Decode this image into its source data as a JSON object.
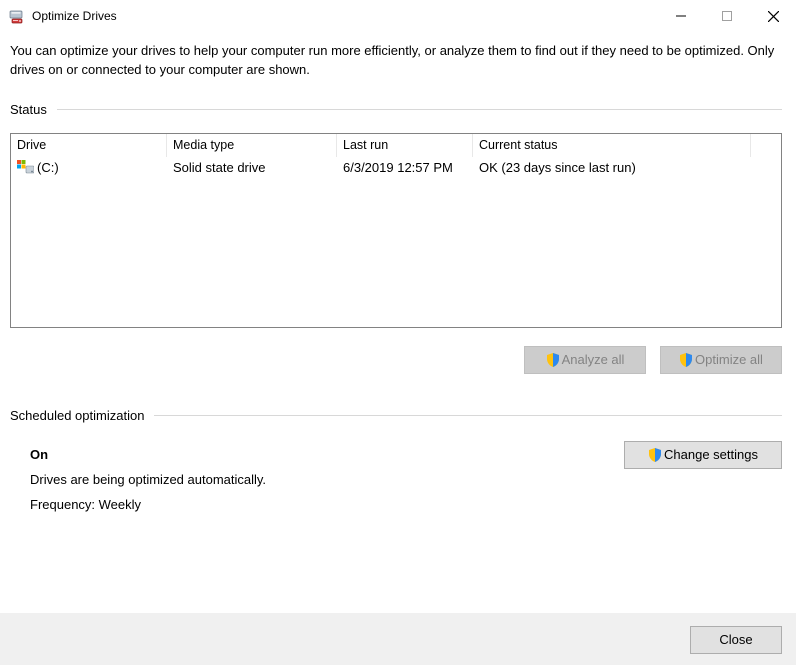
{
  "window": {
    "title": "Optimize Drives"
  },
  "intro": "You can optimize your drives to help your computer run more efficiently, or analyze them to find out if they need to be optimized. Only drives on or connected to your computer are shown.",
  "status": {
    "label": "Status",
    "columns": {
      "drive": "Drive",
      "media": "Media type",
      "last": "Last run",
      "status": "Current status"
    },
    "rows": [
      {
        "drive": "(C:)",
        "media": "Solid state drive",
        "last": "6/3/2019 12:57 PM",
        "status": "OK (23 days since last run)"
      }
    ],
    "analyze": "Analyze all",
    "optimize": "Optimize all"
  },
  "scheduled": {
    "label": "Scheduled optimization",
    "state": "On",
    "desc": "Drives are being optimized automatically.",
    "freq": "Frequency: Weekly",
    "change": "Change settings"
  },
  "footer": {
    "close": "Close"
  }
}
